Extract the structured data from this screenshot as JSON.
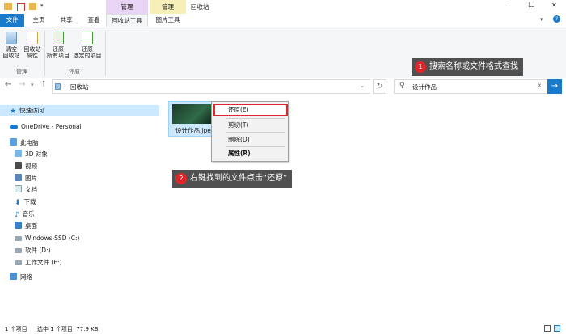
{
  "window": {
    "title": "回收站",
    "context_tab_group_1": "管理",
    "context_tab_group_2": "管理",
    "controls": {
      "minimize": "—",
      "maximize": "□",
      "close": "✕"
    }
  },
  "tabs": [
    {
      "label": "文件"
    },
    {
      "label": "主页"
    },
    {
      "label": "共享"
    },
    {
      "label": "查看"
    },
    {
      "label": "回收站工具"
    },
    {
      "label": "图片工具"
    }
  ],
  "ribbon": {
    "empty_recycle_bin": "清空\n回收站",
    "recycle_bin_properties": "回收站\n属性",
    "restore_all": "还原\n所有项目",
    "restore_selected": "还原\n选定的项目",
    "group_manage": "管理",
    "group_restore": "还原"
  },
  "address": {
    "path": "回收站",
    "search_value": "设计作品"
  },
  "nav": {
    "quick_access": "快速访问",
    "onedrive": "OneDrive - Personal",
    "this_pc": "此电脑",
    "objects_3d": "3D 对象",
    "videos": "视频",
    "pictures": "图片",
    "documents": "文档",
    "downloads": "下载",
    "music": "音乐",
    "desktop": "桌面",
    "drive_c": "Windows-SSD (C:)",
    "drive_d": "软件 (D:)",
    "drive_e": "工作文件 (E:)",
    "network": "网络"
  },
  "file": {
    "name": "设计作品.jpeg"
  },
  "context_menu": {
    "restore": "还原(E)",
    "cut": "剪切(T)",
    "delete": "删除(D)",
    "properties": "属性(R)"
  },
  "annotations": {
    "step1_num": "1",
    "step1_text": "搜索名称或文件格式查找",
    "step2_num": "2",
    "step2_text": "右键找到的文件点击“还原”"
  },
  "status": {
    "count": "1 个项目",
    "selected": "选中 1 个项目  77.9 KB"
  },
  "colors": {
    "accent": "#1979ca",
    "manage_tab_1": "#e8d4f5",
    "manage_tab_2": "#f6f0b8",
    "badge": "#e0262b",
    "highlight": "#e0262b"
  }
}
